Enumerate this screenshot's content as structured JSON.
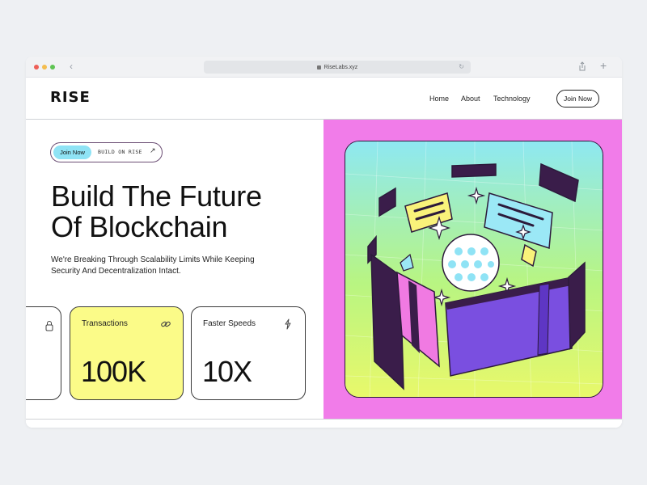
{
  "browser": {
    "url": "RiseLabs.xyz",
    "back_glyph": "‹",
    "new_tab_glyph": "+"
  },
  "header": {
    "logo": "RISE",
    "nav": [
      "Home",
      "About",
      "Technology"
    ],
    "cta": "Join Now"
  },
  "hero": {
    "pill_button": "Join Now",
    "pill_text": "BUILD ON RISE",
    "pill_arrow": "↗",
    "headline_line1": "Build The Future",
    "headline_line2": "Of Blockchain",
    "subtitle": "We're Breaking Through Scalability Limits While Keeping Security And Decentralization Intact."
  },
  "stats": [
    {
      "label": "",
      "value": "",
      "icon": "lock-icon",
      "bg": "#ffffff"
    },
    {
      "label": "Transactions",
      "value": "100K",
      "icon": "link-icon",
      "bg": "#fbfb88"
    },
    {
      "label": "Faster Speeds",
      "value": "10X",
      "icon": "bolt-icon",
      "bg": "#ffffff"
    }
  ],
  "colors": {
    "accent_pink": "#f17ce9",
    "accent_cyan": "#8fe3f5",
    "accent_yellow": "#fbfb88",
    "dark_purple": "#2c1a3b",
    "violet": "#7a4fe0"
  }
}
